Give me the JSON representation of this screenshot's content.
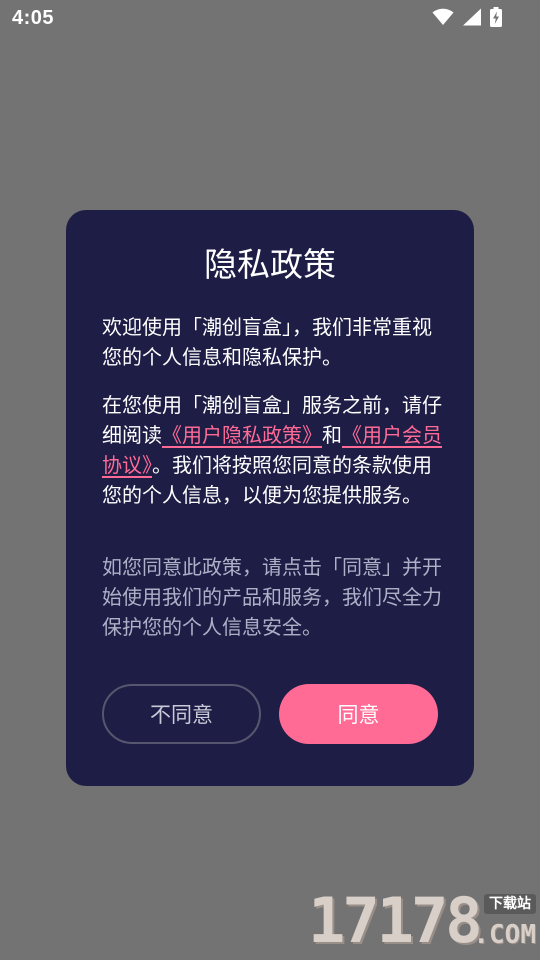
{
  "status_bar": {
    "time": "4:05",
    "icons": [
      "wifi-icon",
      "signal-icon",
      "battery-charging-icon"
    ]
  },
  "dialog": {
    "title": "隐私政策",
    "para1": "欢迎使用「潮创盲盒」，我们非常重视您的个人信息和隐私保护。",
    "para2": {
      "before": "在您使用「潮创盲盒」服务之前，请仔细阅读",
      "link_privacy": "《用户隐私政策》",
      "and": "和",
      "link_member": "《用户会员协议》",
      "after": "。我们将按照您同意的条款使用您的个人信息，以便为您提供服务。"
    },
    "para3": "如您同意此政策，请点击「同意」并开始使用我们的产品和服务，我们尽全力保护您的个人信息安全。",
    "disagree_label": "不同意",
    "agree_label": "同意"
  },
  "watermark": {
    "digits": "17178",
    "badge": "下载站",
    "suffix": ".COM"
  },
  "colors": {
    "backdrop": "#737373",
    "dialog_bg": "#1e1d46",
    "accent": "#ff6b95",
    "muted_text": "#aeb0c8"
  }
}
